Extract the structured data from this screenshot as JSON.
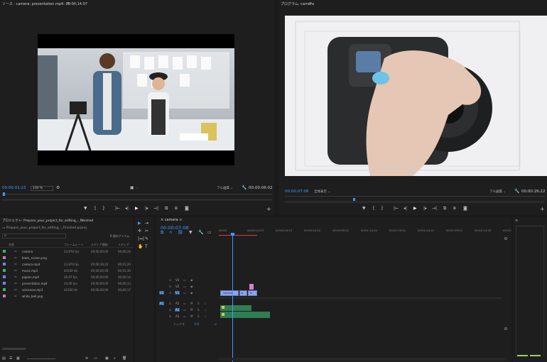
{
  "source": {
    "title": "ソース : camera: presentation.mp4: 00:00:14:07",
    "timecode_in": "00:00:01:23",
    "zoom": "100 %",
    "quality": "フル画質",
    "timecode_out": "00:00:06:02"
  },
  "program": {
    "title": "プログラム: camera",
    "timecode_in": "00:00:07:08",
    "fit": "全体表示",
    "quality": "フル画質",
    "timecode_out": "00:00:26:22"
  },
  "project": {
    "title": "プロジェクト: Prepare_your_project_for_editing_-_Finished",
    "path": "Prepare_your_project_for_editing_-_Finished.prproj",
    "count": "8 個のアイテム",
    "columns": [
      "名前",
      "フレームレート",
      "メディア開始",
      "メディア"
    ],
    "items": [
      {
        "name": "camera",
        "fps": "23,976 fps",
        "start": "00;00;00;00",
        "dur": "00;00;26",
        "color": "#3cb371",
        "icon": "sequence-icon"
      },
      {
        "name": "black_screen.png",
        "fps": "",
        "start": "",
        "dur": "",
        "color": "#c978c9",
        "icon": "image-icon"
      },
      {
        "name": "camera.mp4",
        "fps": "23,976 fps",
        "start": "00;00;19;22",
        "dur": "00;01;20",
        "color": "#7f7fff",
        "icon": "video-icon"
      },
      {
        "name": "music.mp3",
        "fps": "44100 Hz",
        "start": "00;00;00;00",
        "dur": "00;01;30",
        "color": "#3cb371",
        "icon": "audio-icon"
      },
      {
        "name": "pigeon.mp4",
        "fps": "29,97 fps",
        "start": "00;00;00;00",
        "dur": "00;00;14",
        "color": "#7f7fff",
        "icon": "video-icon"
      },
      {
        "name": "presentation.mp4",
        "fps": "24,00 fps",
        "start": "00;00;00;00",
        "dur": "00;00;13",
        "color": "#7f7fff",
        "icon": "video-icon"
      },
      {
        "name": "voiceover.mp3",
        "fps": "44100 Hz",
        "start": "00;00;00;00",
        "dur": "00;00;17",
        "color": "#3cb371",
        "icon": "audio-icon"
      },
      {
        "name": "white_bell.png",
        "fps": "",
        "start": "",
        "dur": "",
        "color": "#c978c9",
        "icon": "image-icon"
      }
    ]
  },
  "timeline": {
    "tab": "camera",
    "timecode": "00:00:07:08",
    "ruler": [
      "00:00",
      "00:00:14:23",
      "00:00:29:23",
      "00:00:44:22",
      "00:00:59:22",
      "00:01:14:22",
      "00:01:29:21",
      "00:01:44:21",
      "00:01:59:21",
      "00:02:14:20",
      "00:02:"
    ],
    "video_tracks": [
      "V3",
      "V2",
      "V1"
    ],
    "audio_tracks": [
      "A1",
      "A2",
      "A3"
    ],
    "source_patch_v": "V1",
    "source_patch_a": "A1",
    "mix_label": "ミックス",
    "mix_value": "0,0",
    "clip_labels": [
      "camera",
      "fx",
      "fx"
    ]
  },
  "colors": {
    "accent": "#3b9bff",
    "video_clip": "#8fa6e6",
    "audio_clip": "#2f7d53",
    "pink_clip": "#d77fd7"
  }
}
